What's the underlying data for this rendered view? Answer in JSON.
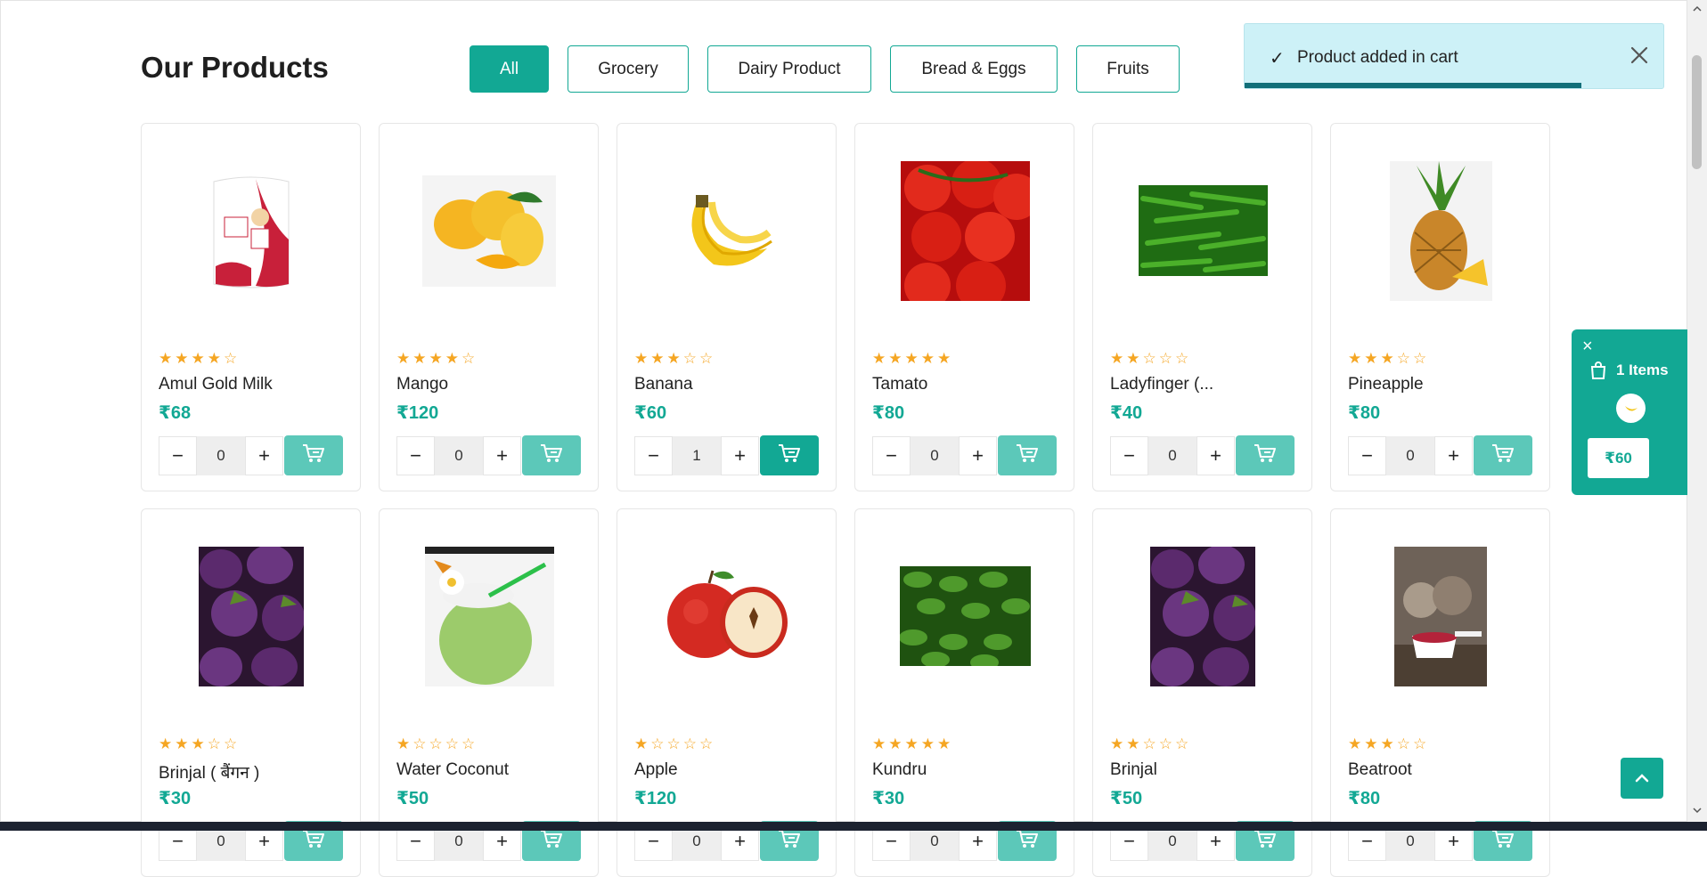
{
  "section": {
    "title": "Our Products"
  },
  "filters": [
    {
      "label": "All",
      "active": true
    },
    {
      "label": "Grocery",
      "active": false
    },
    {
      "label": "Dairy Product",
      "active": false
    },
    {
      "label": "Bread & Eggs",
      "active": false
    },
    {
      "label": "Fruits",
      "active": false
    }
  ],
  "products": [
    {
      "name": "Amul Gold Milk",
      "price": "₹68",
      "rating": 4,
      "qty": "0",
      "image": "milk-pouch"
    },
    {
      "name": "Mango",
      "price": "₹120",
      "rating": 4,
      "qty": "0",
      "image": "mango"
    },
    {
      "name": "Banana",
      "price": "₹60",
      "rating": 3,
      "qty": "1",
      "image": "banana"
    },
    {
      "name": "Tamato",
      "price": "₹80",
      "rating": 5,
      "qty": "0",
      "image": "tomato"
    },
    {
      "name": "Ladyfinger (...",
      "price": "₹40",
      "rating": 2,
      "qty": "0",
      "image": "okra"
    },
    {
      "name": "Pineapple",
      "price": "₹80",
      "rating": 3,
      "qty": "0",
      "image": "pineapple"
    },
    {
      "name": "Brinjal ( बैंगन )",
      "price": "₹30",
      "rating": 3,
      "qty": "0",
      "image": "brinjal"
    },
    {
      "name": "Water Coconut",
      "price": "₹50",
      "rating": 1,
      "qty": "0",
      "image": "coconut"
    },
    {
      "name": "Apple",
      "price": "₹120",
      "rating": 1,
      "qty": "0",
      "image": "apple"
    },
    {
      "name": "Kundru",
      "price": "₹30",
      "rating": 5,
      "qty": "0",
      "image": "kundru"
    },
    {
      "name": "Brinjal",
      "price": "₹50",
      "rating": 2,
      "qty": "0",
      "image": "brinjal"
    },
    {
      "name": "Beatroot",
      "price": "₹80",
      "rating": 3,
      "qty": "0",
      "image": "beetroot"
    }
  ],
  "toast": {
    "message": "Product added in cart"
  },
  "cart_widget": {
    "close": "×",
    "items_label": "1 Items",
    "total": "₹60"
  },
  "colors": {
    "accent": "#12a894",
    "accent_light": "#5cc8b9",
    "star": "#f5a623",
    "toast_bg": "#cdf1f7"
  }
}
